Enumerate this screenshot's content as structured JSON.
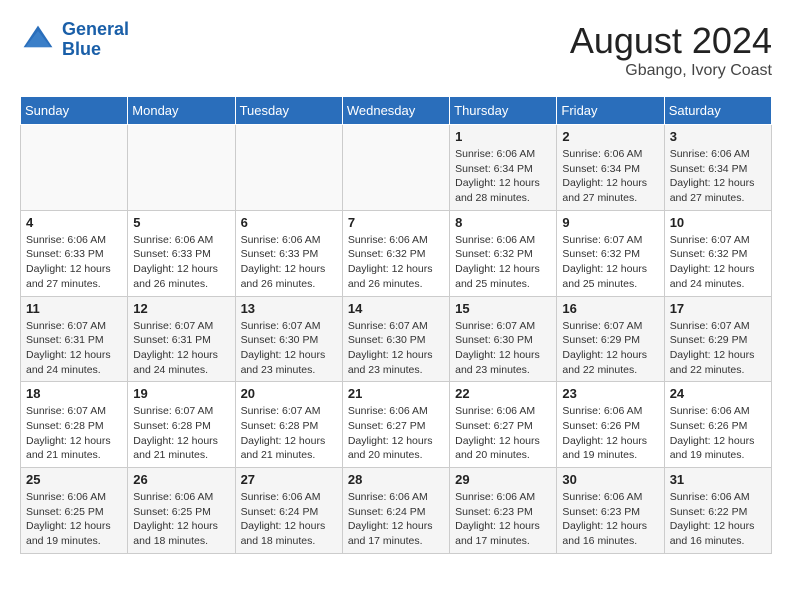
{
  "header": {
    "logo_line1": "General",
    "logo_line2": "Blue",
    "month_year": "August 2024",
    "location": "Gbango, Ivory Coast"
  },
  "weekdays": [
    "Sunday",
    "Monday",
    "Tuesday",
    "Wednesday",
    "Thursday",
    "Friday",
    "Saturday"
  ],
  "weeks": [
    [
      {
        "day": "",
        "info": ""
      },
      {
        "day": "",
        "info": ""
      },
      {
        "day": "",
        "info": ""
      },
      {
        "day": "",
        "info": ""
      },
      {
        "day": "1",
        "info": "Sunrise: 6:06 AM\nSunset: 6:34 PM\nDaylight: 12 hours\nand 28 minutes."
      },
      {
        "day": "2",
        "info": "Sunrise: 6:06 AM\nSunset: 6:34 PM\nDaylight: 12 hours\nand 27 minutes."
      },
      {
        "day": "3",
        "info": "Sunrise: 6:06 AM\nSunset: 6:34 PM\nDaylight: 12 hours\nand 27 minutes."
      }
    ],
    [
      {
        "day": "4",
        "info": "Sunrise: 6:06 AM\nSunset: 6:33 PM\nDaylight: 12 hours\nand 27 minutes."
      },
      {
        "day": "5",
        "info": "Sunrise: 6:06 AM\nSunset: 6:33 PM\nDaylight: 12 hours\nand 26 minutes."
      },
      {
        "day": "6",
        "info": "Sunrise: 6:06 AM\nSunset: 6:33 PM\nDaylight: 12 hours\nand 26 minutes."
      },
      {
        "day": "7",
        "info": "Sunrise: 6:06 AM\nSunset: 6:32 PM\nDaylight: 12 hours\nand 26 minutes."
      },
      {
        "day": "8",
        "info": "Sunrise: 6:06 AM\nSunset: 6:32 PM\nDaylight: 12 hours\nand 25 minutes."
      },
      {
        "day": "9",
        "info": "Sunrise: 6:07 AM\nSunset: 6:32 PM\nDaylight: 12 hours\nand 25 minutes."
      },
      {
        "day": "10",
        "info": "Sunrise: 6:07 AM\nSunset: 6:32 PM\nDaylight: 12 hours\nand 24 minutes."
      }
    ],
    [
      {
        "day": "11",
        "info": "Sunrise: 6:07 AM\nSunset: 6:31 PM\nDaylight: 12 hours\nand 24 minutes."
      },
      {
        "day": "12",
        "info": "Sunrise: 6:07 AM\nSunset: 6:31 PM\nDaylight: 12 hours\nand 24 minutes."
      },
      {
        "day": "13",
        "info": "Sunrise: 6:07 AM\nSunset: 6:30 PM\nDaylight: 12 hours\nand 23 minutes."
      },
      {
        "day": "14",
        "info": "Sunrise: 6:07 AM\nSunset: 6:30 PM\nDaylight: 12 hours\nand 23 minutes."
      },
      {
        "day": "15",
        "info": "Sunrise: 6:07 AM\nSunset: 6:30 PM\nDaylight: 12 hours\nand 23 minutes."
      },
      {
        "day": "16",
        "info": "Sunrise: 6:07 AM\nSunset: 6:29 PM\nDaylight: 12 hours\nand 22 minutes."
      },
      {
        "day": "17",
        "info": "Sunrise: 6:07 AM\nSunset: 6:29 PM\nDaylight: 12 hours\nand 22 minutes."
      }
    ],
    [
      {
        "day": "18",
        "info": "Sunrise: 6:07 AM\nSunset: 6:28 PM\nDaylight: 12 hours\nand 21 minutes."
      },
      {
        "day": "19",
        "info": "Sunrise: 6:07 AM\nSunset: 6:28 PM\nDaylight: 12 hours\nand 21 minutes."
      },
      {
        "day": "20",
        "info": "Sunrise: 6:07 AM\nSunset: 6:28 PM\nDaylight: 12 hours\nand 21 minutes."
      },
      {
        "day": "21",
        "info": "Sunrise: 6:06 AM\nSunset: 6:27 PM\nDaylight: 12 hours\nand 20 minutes."
      },
      {
        "day": "22",
        "info": "Sunrise: 6:06 AM\nSunset: 6:27 PM\nDaylight: 12 hours\nand 20 minutes."
      },
      {
        "day": "23",
        "info": "Sunrise: 6:06 AM\nSunset: 6:26 PM\nDaylight: 12 hours\nand 19 minutes."
      },
      {
        "day": "24",
        "info": "Sunrise: 6:06 AM\nSunset: 6:26 PM\nDaylight: 12 hours\nand 19 minutes."
      }
    ],
    [
      {
        "day": "25",
        "info": "Sunrise: 6:06 AM\nSunset: 6:25 PM\nDaylight: 12 hours\nand 19 minutes."
      },
      {
        "day": "26",
        "info": "Sunrise: 6:06 AM\nSunset: 6:25 PM\nDaylight: 12 hours\nand 18 minutes."
      },
      {
        "day": "27",
        "info": "Sunrise: 6:06 AM\nSunset: 6:24 PM\nDaylight: 12 hours\nand 18 minutes."
      },
      {
        "day": "28",
        "info": "Sunrise: 6:06 AM\nSunset: 6:24 PM\nDaylight: 12 hours\nand 17 minutes."
      },
      {
        "day": "29",
        "info": "Sunrise: 6:06 AM\nSunset: 6:23 PM\nDaylight: 12 hours\nand 17 minutes."
      },
      {
        "day": "30",
        "info": "Sunrise: 6:06 AM\nSunset: 6:23 PM\nDaylight: 12 hours\nand 16 minutes."
      },
      {
        "day": "31",
        "info": "Sunrise: 6:06 AM\nSunset: 6:22 PM\nDaylight: 12 hours\nand 16 minutes."
      }
    ]
  ]
}
